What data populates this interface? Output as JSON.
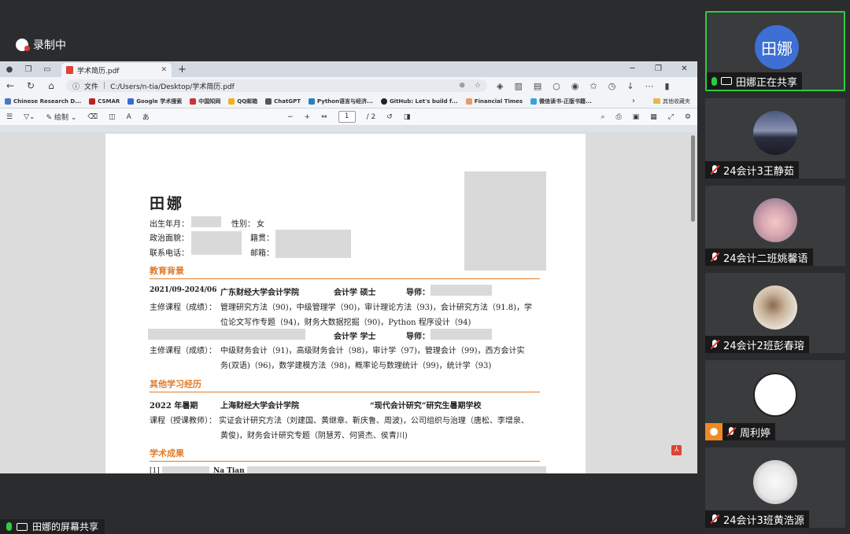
{
  "recording": {
    "label": "录制中"
  },
  "browser": {
    "tab_title": "学术简历.pdf",
    "url_prefix": "文件",
    "url": "C:/Users/n-tia/Desktop/学术简历.pdf",
    "bookmarks": [
      "Chinese Research D...",
      "CSMAR",
      "Google 学术搜索",
      "中国知网",
      "QQ邮箱",
      "ChatGPT",
      "Python语言与经济...",
      "GitHub: Let's build f...",
      "Financial Times",
      "微信读书-正版书籍..."
    ],
    "bookmarks_folder": "其他收藏夹",
    "pdf_toolbar": {
      "draw_label": "绘制",
      "page_current": "1",
      "page_total": "/ 2"
    }
  },
  "resume": {
    "name": "田娜",
    "birth_label": "出生年月：",
    "gender_label": "性别：",
    "gender_value": "女",
    "politics_label": "政治面貌：",
    "origin_label": "籍贯：",
    "phone_label": "联系电话：",
    "email_label": "邮箱：",
    "edu_title": "教育背景",
    "edu1": {
      "period": "2021/09-2024/06",
      "school": "广东财经大学会计学院",
      "major": "会计学  硕士",
      "advisor_label": "导师："
    },
    "courses_label": "主修课程（成绩）：",
    "edu1_courses_1": "管理研究方法（90)，中级管理学（90)，审计理论方法（93)，会计研究方法（91.8)，学",
    "edu1_courses_2": "位论文写作专题（94)，财务大数据挖掘（90)，Python 程序设计（94)",
    "edu2": {
      "major": "会计学  学士",
      "advisor_label": "导师："
    },
    "edu2_courses_1": "中级财务会计（91)，高级财务会计（98)，审计学（97)，管理会计（99)，西方会计实",
    "edu2_courses_2": "务(双语)（96)，数学建模方法（98)，概率论与数理统计（99)，统计学（93)",
    "other_title": "其他学习经历",
    "other1": {
      "period": "2022 年暑期",
      "school": "上海财经大学会计学院",
      "program": "“现代会计研究”研究生暑期学校"
    },
    "other_courses_label": "课程（授课教师）：",
    "other_courses_1": "实证会计研究方法（刘建国、黄继章、靳庆鲁、周波)，公司组织与治理（唐松、李增泉、",
    "other_courses_2": "黄俊)，财务会计研究专题（阴慧芳、何贤杰、侯青川)",
    "research_title": "学术成果",
    "research_ref": "[1]",
    "research_author": "Na Tian"
  },
  "share_bar": {
    "label": "田娜的屏幕共享"
  },
  "participants": [
    {
      "name": "田娜",
      "status": "田娜正在共享",
      "avatar_text": "田娜",
      "avatar_color": "#3d6fd4"
    },
    {
      "name": "24会计3王静茹"
    },
    {
      "name": "24会计二班姚馨语"
    },
    {
      "name": "24会计2班彭春瑢"
    },
    {
      "name": "周利婷"
    },
    {
      "name": "24会计3班黄浩源"
    }
  ]
}
